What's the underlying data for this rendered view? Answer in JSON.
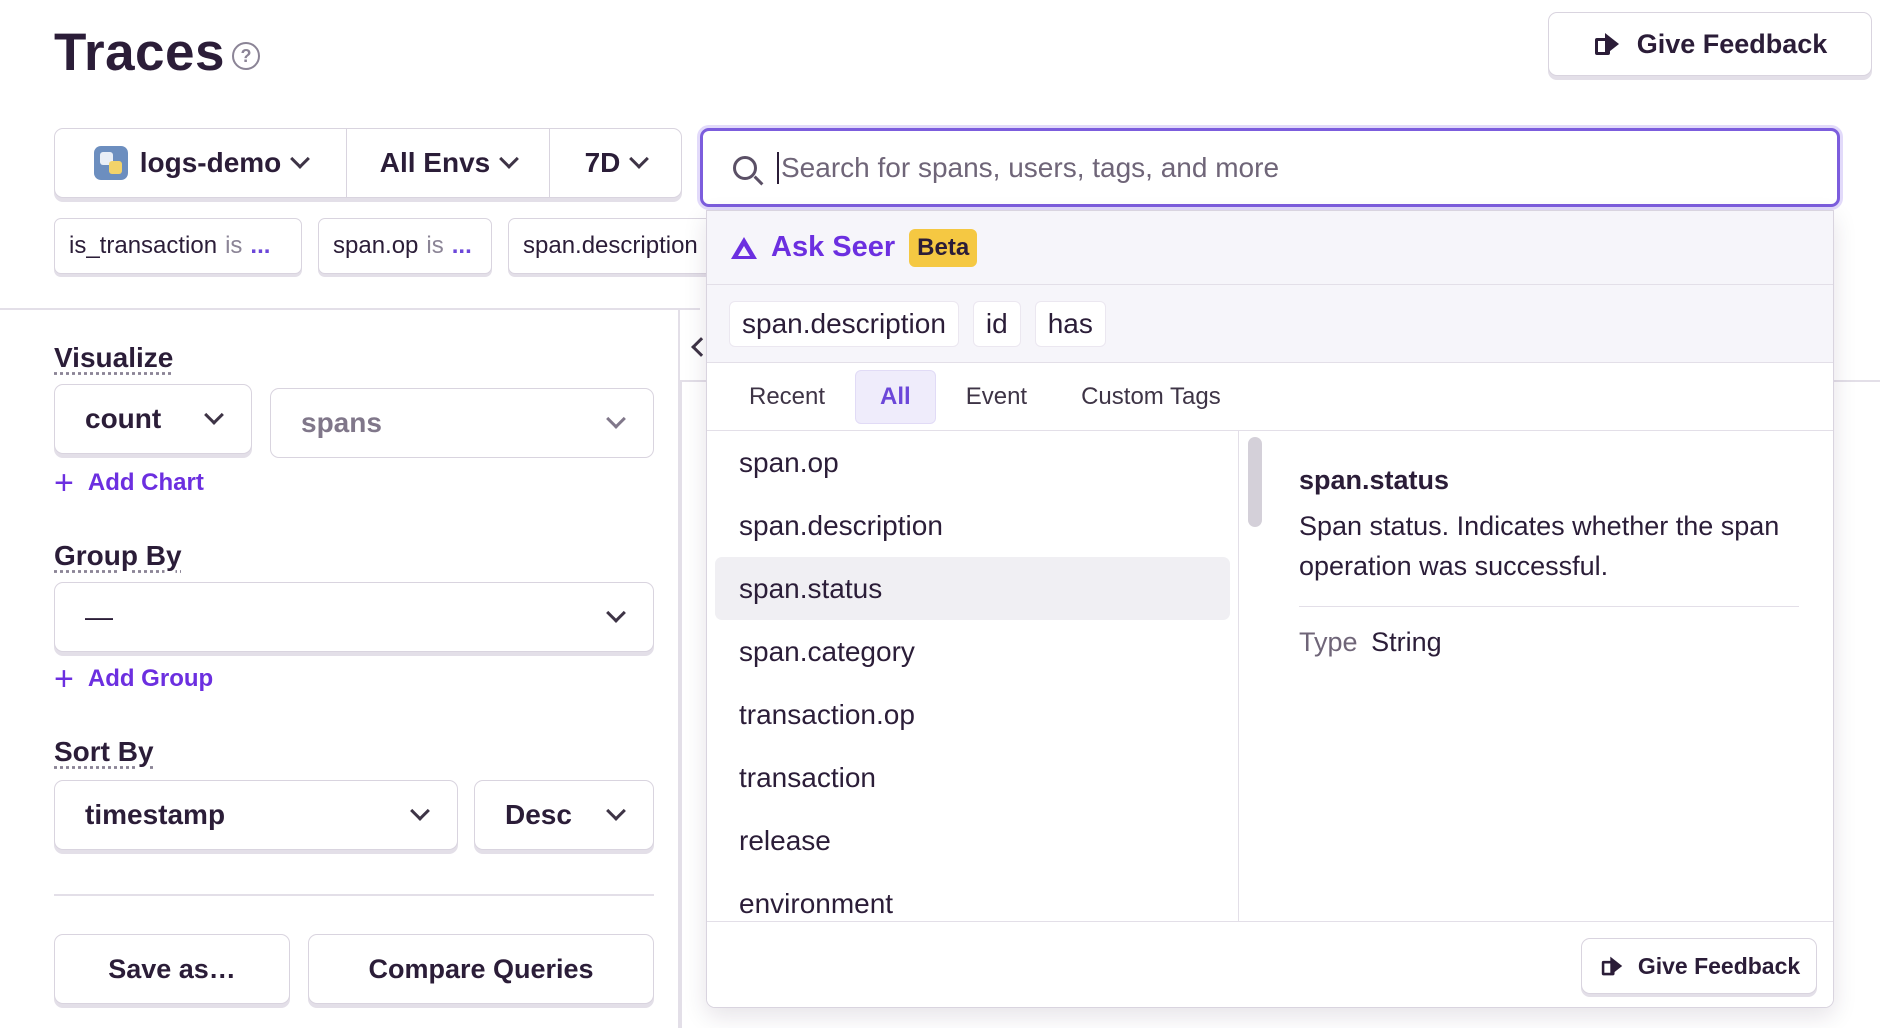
{
  "header": {
    "title": "Traces",
    "help_glyph": "?",
    "feedback_label": "Give Feedback"
  },
  "selectors": {
    "project": "logs-demo",
    "environment": "All Envs",
    "date_range": "7D"
  },
  "search": {
    "placeholder": "Search for spans, users, tags, and more",
    "value": ""
  },
  "filters": [
    {
      "key": "is_transaction",
      "op": "is",
      "value": "..."
    },
    {
      "key": "span.op",
      "op": "is",
      "value": "..."
    },
    {
      "key": "span.description",
      "op": "",
      "value": ""
    }
  ],
  "left_panel": {
    "visualize_label": "Visualize",
    "visualize_function": "count",
    "visualize_field": "spans",
    "add_chart_label": "Add Chart",
    "group_by_label": "Group By",
    "group_by_value": "—",
    "add_group_label": "Add Group",
    "sort_by_label": "Sort By",
    "sort_field": "timestamp",
    "sort_order": "Desc",
    "save_as_label": "Save as…",
    "compare_label": "Compare Queries"
  },
  "popover": {
    "seer_label": "Ask Seer",
    "beta_label": "Beta",
    "suggestions": [
      "span.description",
      "id",
      "has"
    ],
    "tabs": [
      "Recent",
      "All",
      "Event",
      "Custom Tags"
    ],
    "active_tab": "All",
    "items": [
      "span.op",
      "span.description",
      "span.status",
      "span.category",
      "transaction.op",
      "transaction",
      "release",
      "environment"
    ],
    "highlighted_item": "span.status",
    "detail": {
      "title": "span.status",
      "description": "Span status. Indicates whether the span operation was successful.",
      "type_key": "Type",
      "type_value": "String"
    },
    "feedback_label": "Give Feedback"
  },
  "colors": {
    "accent": "#6c2fe0",
    "focus_border": "#7c5ddd",
    "beta_badge": "#f5c842"
  }
}
